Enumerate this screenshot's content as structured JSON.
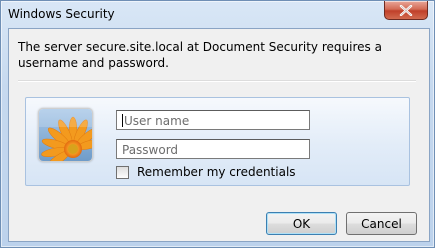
{
  "window": {
    "title": "Windows Security",
    "close_icon": "close-icon"
  },
  "message": "The server secure.site.local at Document Security requires a username and password.",
  "credentials": {
    "user_tile_icon": "flower-user-tile-icon",
    "username": {
      "placeholder": "User name",
      "value": ""
    },
    "password": {
      "placeholder": "Password",
      "value": ""
    },
    "remember_label": "Remember my credentials",
    "remember_checked": false
  },
  "buttons": {
    "ok": "OK",
    "cancel": "Cancel"
  }
}
